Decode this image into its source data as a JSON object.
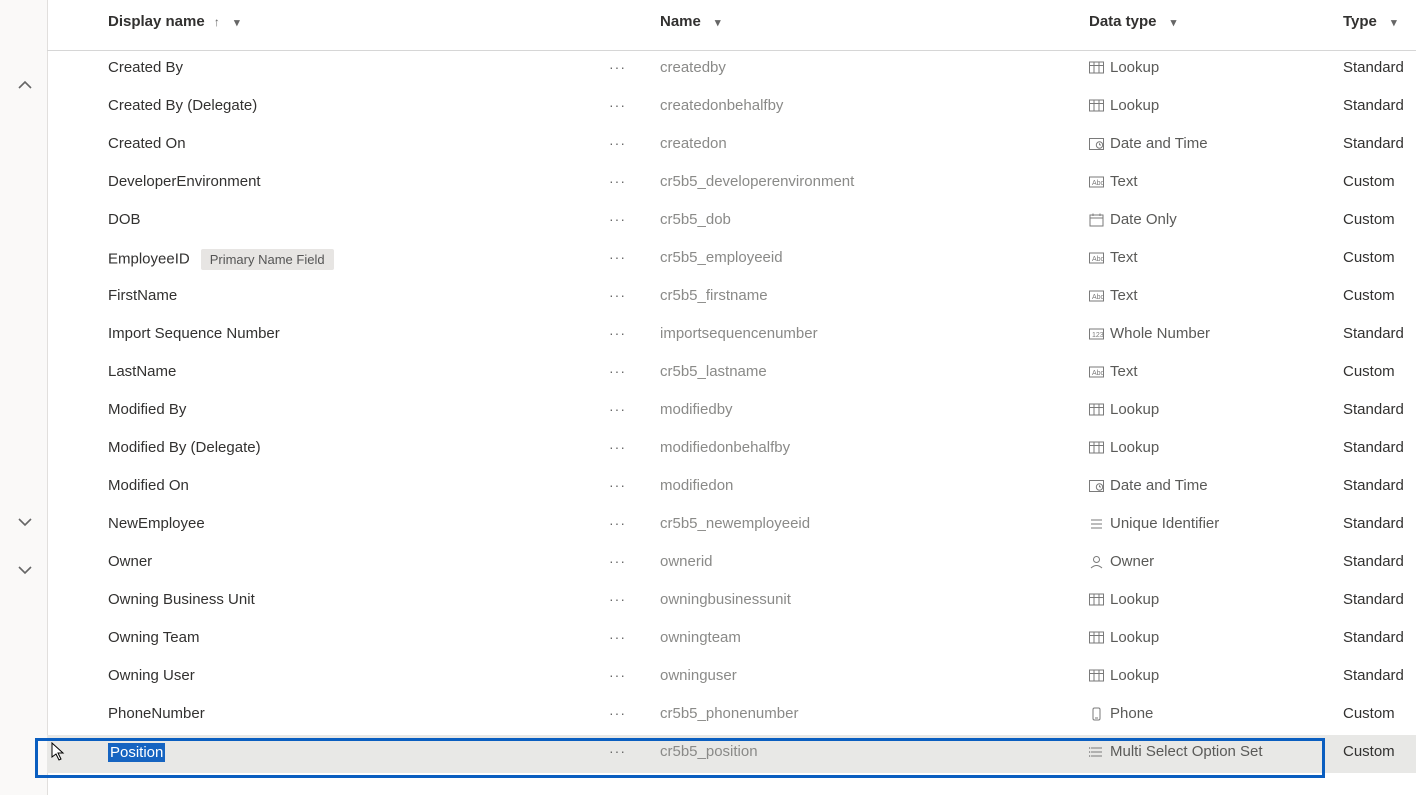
{
  "columns": {
    "display": "Display name",
    "name": "Name",
    "datatype": "Data type",
    "type": "Type"
  },
  "badge_primary": "Primary Name Field",
  "rows": [
    {
      "display": "Created By",
      "name": "createdby",
      "datatype": "Lookup",
      "icon": "lookup",
      "type": "Standard"
    },
    {
      "display": "Created By (Delegate)",
      "name": "createdonbehalfby",
      "datatype": "Lookup",
      "icon": "lookup",
      "type": "Standard"
    },
    {
      "display": "Created On",
      "name": "createdon",
      "datatype": "Date and Time",
      "icon": "datetime",
      "type": "Standard"
    },
    {
      "display": "DeveloperEnvironment",
      "name": "cr5b5_developerenvironment",
      "datatype": "Text",
      "icon": "text",
      "type": "Custom"
    },
    {
      "display": "DOB",
      "name": "cr5b5_dob",
      "datatype": "Date Only",
      "icon": "date",
      "type": "Custom"
    },
    {
      "display": "EmployeeID",
      "name": "cr5b5_employeeid",
      "datatype": "Text",
      "icon": "text",
      "type": "Custom",
      "primary": true
    },
    {
      "display": "FirstName",
      "name": "cr5b5_firstname",
      "datatype": "Text",
      "icon": "text",
      "type": "Custom"
    },
    {
      "display": "Import Sequence Number",
      "name": "importsequencenumber",
      "datatype": "Whole Number",
      "icon": "number",
      "type": "Standard"
    },
    {
      "display": "LastName",
      "name": "cr5b5_lastname",
      "datatype": "Text",
      "icon": "text",
      "type": "Custom"
    },
    {
      "display": "Modified By",
      "name": "modifiedby",
      "datatype": "Lookup",
      "icon": "lookup",
      "type": "Standard"
    },
    {
      "display": "Modified By (Delegate)",
      "name": "modifiedonbehalfby",
      "datatype": "Lookup",
      "icon": "lookup",
      "type": "Standard"
    },
    {
      "display": "Modified On",
      "name": "modifiedon",
      "datatype": "Date and Time",
      "icon": "datetime",
      "type": "Standard"
    },
    {
      "display": "NewEmployee",
      "name": "cr5b5_newemployeeid",
      "datatype": "Unique Identifier",
      "icon": "uid",
      "type": "Standard"
    },
    {
      "display": "Owner",
      "name": "ownerid",
      "datatype": "Owner",
      "icon": "owner",
      "type": "Standard"
    },
    {
      "display": "Owning Business Unit",
      "name": "owningbusinessunit",
      "datatype": "Lookup",
      "icon": "lookup",
      "type": "Standard"
    },
    {
      "display": "Owning Team",
      "name": "owningteam",
      "datatype": "Lookup",
      "icon": "lookup",
      "type": "Standard"
    },
    {
      "display": "Owning User",
      "name": "owninguser",
      "datatype": "Lookup",
      "icon": "lookup",
      "type": "Standard"
    },
    {
      "display": "PhoneNumber",
      "name": "cr5b5_phonenumber",
      "datatype": "Phone",
      "icon": "phone",
      "type": "Custom"
    },
    {
      "display": "Position",
      "name": "cr5b5_position",
      "datatype": "Multi Select Option Set",
      "icon": "multiselect",
      "type": "Custom",
      "selected": true
    }
  ]
}
